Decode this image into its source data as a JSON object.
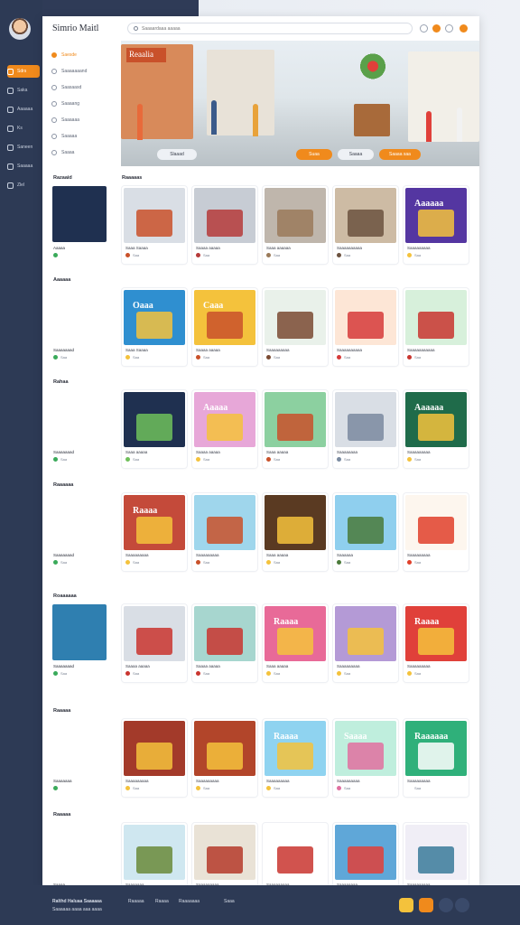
{
  "rail": {
    "items": [
      {
        "label": "Sdrs",
        "active": true
      },
      {
        "label": "Saka",
        "active": false
      },
      {
        "label": "Aaaaaa",
        "active": false
      },
      {
        "label": "Ks",
        "active": false
      },
      {
        "label": "Saneen",
        "active": false
      },
      {
        "label": "Saaaaa",
        "active": false
      },
      {
        "label": "Zlel",
        "active": false
      }
    ]
  },
  "header": {
    "brand": "Simrio Maitl",
    "search_placeholder": "Saaaardaaa aaaaa"
  },
  "sidebar": {
    "items": [
      {
        "label": "Saesde",
        "active": true
      },
      {
        "label": "Saaaaaaand",
        "active": false
      },
      {
        "label": "Saasaasd",
        "active": false
      },
      {
        "label": "Saaaang",
        "active": false
      },
      {
        "label": "Saaaaaa",
        "active": false
      },
      {
        "label": "Saaaaa",
        "active": false
      },
      {
        "label": "Saaaa",
        "active": false
      }
    ]
  },
  "hero": {
    "sign": "Reaalia",
    "buttons": [
      "Slaaad",
      "Suaa",
      "Saaaa",
      "Saaaa saa"
    ]
  },
  "sections": {
    "left_labels": [
      "Razaaid",
      "Aaaaaa",
      "Rahaa",
      "Raaaaaa",
      "Roaaaaaa",
      "Raaaaa",
      "Raaaaa"
    ],
    "main_label": "Raaaaas"
  },
  "left_cards": [
    {
      "title": "Aaaaa",
      "meta": ""
    },
    {
      "title": "Saaaaaaad",
      "meta": "Saa"
    },
    {
      "title": "Saaaaaaad",
      "meta": "Saa"
    },
    {
      "title": "Saaaaaaad",
      "meta": "Saa"
    },
    {
      "title": "Saaaaaaad",
      "meta": "Saa"
    },
    {
      "title": "Saaaaaaa",
      "meta": ""
    },
    {
      "title": "Saaaa",
      "meta": ""
    }
  ],
  "cards": [
    {
      "title": "Saaa Saaaa",
      "meta": "Saa",
      "color": "#d9dee5",
      "accent": "#c9512a",
      "label": ""
    },
    {
      "title": "Saaaa aaaaa",
      "meta": "Saa",
      "color": "#c7ccd4",
      "accent": "#b53a3a",
      "label": ""
    },
    {
      "title": "Saaa aaaaaa",
      "meta": "Saa",
      "color": "#bfb6ac",
      "accent": "#9a7a5a",
      "label": ""
    },
    {
      "title": "Saaaaaaaaaa",
      "meta": "Saa",
      "color": "#cdbba4",
      "accent": "#6b5240",
      "label": ""
    },
    {
      "title": "Saaaaaaaaa",
      "meta": "Saa",
      "color": "#5436a1",
      "accent": "#f4c23c",
      "label": "Aaaaaa"
    },
    {
      "title": "Saaa Saaaa",
      "meta": "Saa",
      "color": "#2f8fd0",
      "accent": "#f4c23c",
      "label": "Oaaa"
    },
    {
      "title": "Saaaa aaaaa",
      "meta": "Saa",
      "color": "#f4c23c",
      "accent": "#c9512a",
      "label": "Caaa"
    },
    {
      "title": "Saaaaaaaaa",
      "meta": "Saa",
      "color": "#e9f1ea",
      "accent": "#7a4a32",
      "label": ""
    },
    {
      "title": "Saaaaaaaaaa",
      "meta": "Saa",
      "color": "#fde6d6",
      "accent": "#d63a3a",
      "label": ""
    },
    {
      "title": "Saaaaaaaaaaa",
      "meta": "Saa",
      "color": "#d7f0db",
      "accent": "#c9352f",
      "label": ""
    },
    {
      "title": "Saaa aaaaa",
      "meta": "Saa",
      "color": "#1f3050",
      "accent": "#6fbf5a",
      "label": ""
    },
    {
      "title": "Saaaa aaaaa",
      "meta": "Saa",
      "color": "#e7a7d8",
      "accent": "#f4c23c",
      "label": "Aaaaa"
    },
    {
      "title": "Saaa aaaaa",
      "meta": "Saa",
      "color": "#8cd0a0",
      "accent": "#c9512a",
      "label": ""
    },
    {
      "title": "Saaaaaaaa",
      "meta": "Saa",
      "color": "#d9dee5",
      "accent": "#7a8aa0",
      "label": ""
    },
    {
      "title": "Saaaaaaaaa",
      "meta": "Saa",
      "color": "#1f6b4a",
      "accent": "#f4c23c",
      "label": "Aaaaaa"
    },
    {
      "title": "Saaaaaaaaa",
      "meta": "Saa",
      "color": "#c44a3a",
      "accent": "#f4c23c",
      "label": "Raaaa"
    },
    {
      "title": "Saaaaaaaaa",
      "meta": "Saa",
      "color": "#9fd6ec",
      "accent": "#c9512a",
      "label": ""
    },
    {
      "title": "Saaa aaaaa",
      "meta": "Saa",
      "color": "#5a3a22",
      "accent": "#f4c23c",
      "label": ""
    },
    {
      "title": "Saaaaaa",
      "meta": "Saa",
      "color": "#8fcfee",
      "accent": "#4a7a3a",
      "label": ""
    },
    {
      "title": "Saaaaaaaaa",
      "meta": "Saa",
      "color": "#fdf6ee",
      "accent": "#e0402a",
      "label": ""
    },
    {
      "title": "Saaaa aaaaa",
      "meta": "Saa",
      "color": "#d9dee5",
      "accent": "#c9352f",
      "label": ""
    },
    {
      "title": "Saaaa aaaaa",
      "meta": "Saa",
      "color": "#a7d6cf",
      "accent": "#c9352f",
      "label": ""
    },
    {
      "title": "Saaa aaaaa",
      "meta": "Saa",
      "color": "#e86a98",
      "accent": "#f4c23c",
      "label": "Raaaa"
    },
    {
      "title": "Saaaaaaaaa",
      "meta": "Saa",
      "color": "#b49ad6",
      "accent": "#f4c23c",
      "label": ""
    },
    {
      "title": "Saaaaaaaaa",
      "meta": "Saa",
      "color": "#e0403a",
      "accent": "#f4c23c",
      "label": "Raaaa"
    },
    {
      "title": "Saaaaaaaaa",
      "meta": "Saa",
      "color": "#a33a2a",
      "accent": "#f4c23c",
      "label": ""
    },
    {
      "title": "Saaaaaaaaa",
      "meta": "Saa",
      "color": "#b2452a",
      "accent": "#f4c23c",
      "label": ""
    },
    {
      "title": "Saaaaaaaaa",
      "meta": "Saa",
      "color": "#8fd3f0",
      "accent": "#f4c23c",
      "label": "Raaaa"
    },
    {
      "title": "Saaaaaaaaa",
      "meta": "Saa",
      "color": "#bfeedd",
      "accent": "#e070a0",
      "label": "Saaaa"
    },
    {
      "title": "Saaaaaaaaa",
      "meta": "Saa",
      "color": "#2fb07a",
      "accent": "#fff",
      "label": "Raaaaaa"
    },
    {
      "title": "Saaaaaaa",
      "meta": "Saa",
      "color": "#cfe7f0",
      "accent": "#6a8a3a",
      "label": ""
    },
    {
      "title": "Saaaaaaaaa",
      "meta": "Saa",
      "color": "#e9e2d6",
      "accent": "#b53a2a",
      "label": ""
    },
    {
      "title": "Saaaaaaaaa",
      "meta": "Saa",
      "color": "#fff",
      "accent": "#c9352f",
      "label": ""
    },
    {
      "title": "Saaaaaaaa",
      "meta": "Saa",
      "color": "#5fa7d8",
      "accent": "#e0403a",
      "label": ""
    },
    {
      "title": "Saaaaaaaaa",
      "meta": "Saa",
      "color": "#f0eef6",
      "accent": "#3a7a9a",
      "label": ""
    }
  ],
  "footer": {
    "line1": "Ralthd Haluaa Saaaaaa",
    "line2": "Saaaaaa aaaa aaa aaaa",
    "links": [
      "Raaaaa",
      "Raaaa",
      "Raaaaaaa",
      "Saaa"
    ]
  }
}
